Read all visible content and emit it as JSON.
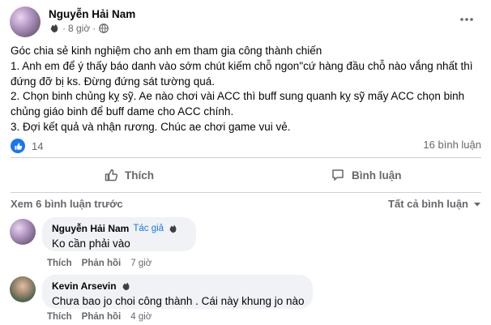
{
  "post": {
    "author": "Nguyễn Hải Nam",
    "time": "8 giờ",
    "separator": "·",
    "lines": [
      "Góc chia sẻ kinh nghiệm cho anh em tham gia công thành chiến",
      "1. Anh em để ý thấy báo danh vào sớm chút kiếm chỗ ngon\"cứ hàng đầu chỗ nào vắng nhất thì",
      "đứng đỡ bị ks. Đừng đứng sát tường quá.",
      "2. Chọn binh chủng kỵ sỹ. Ae nào chơi vài ACC thì buff sung quanh kỵ sỹ mấy ACC chọn binh",
      "chủng giáo binh để buff dame cho ACC chính.",
      "3. Đợi kết quả và nhận rương. Chúc ae chơi game vui vẻ."
    ],
    "reaction_count": "14",
    "comment_count": "16 bình luận",
    "icons": {
      "badge": "fist-badge-icon",
      "privacy": "globe-icon",
      "more": "more-dots-icon",
      "like": "thumbs-up-icon",
      "comment": "comment-icon"
    },
    "accent": "#1877f2"
  },
  "actions": {
    "like_label": "Thích",
    "comment_label": "Bình luận"
  },
  "comments_section": {
    "view_more": "Xem 6 bình luận trước",
    "sort_label": "Tất cả bình luận",
    "items": [
      {
        "author": "Nguyễn Hải Nam",
        "author_tag": "Tác giả",
        "text": "Ko cần phải vào",
        "like_label": "Thích",
        "reply_label": "Phản hồi",
        "time": "7 giờ"
      },
      {
        "author": "Kevin Arsevin",
        "text": "Chưa bao jo choi công thành . Cái này khung jo nào",
        "like_label": "Thích",
        "reply_label": "Phản hồi",
        "time": "4 giờ"
      }
    ]
  }
}
